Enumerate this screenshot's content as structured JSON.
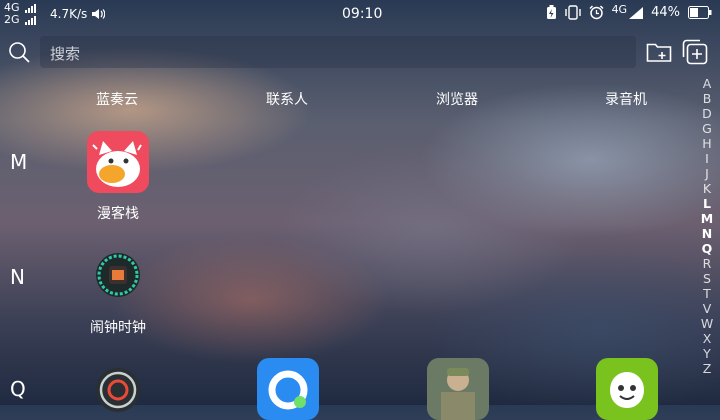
{
  "status_bar": {
    "sig1": "4G",
    "sig2": "2G",
    "net_speed": "4.7K/s",
    "time": "09:10",
    "net_type": "4G",
    "battery": "44%"
  },
  "search": {
    "placeholder": "搜索"
  },
  "top_row_labels": [
    "蓝奏云",
    "联系人",
    "浏览器",
    "录音机"
  ],
  "sections": [
    {
      "letter": "M",
      "app": {
        "name": "漫客栈",
        "icon": "manhua-cat-icon"
      }
    },
    {
      "letter": "N",
      "app": {
        "name": "闹钟时钟",
        "icon": "alarm-clock-icon"
      }
    },
    {
      "letter": "Q"
    }
  ],
  "index_letters": [
    "A",
    "B",
    "D",
    "G",
    "H",
    "I",
    "J",
    "K",
    "L",
    "M",
    "N",
    "Q",
    "R",
    "S",
    "T",
    "V",
    "W",
    "X",
    "Y",
    "Z"
  ],
  "index_strong": [
    "L",
    "M",
    "N",
    "Q"
  ],
  "colors": {
    "manhua_bg": "#f04a5e",
    "qbrowser_bg": "#2a8cf0",
    "green_app_bg": "#7ac21e"
  }
}
